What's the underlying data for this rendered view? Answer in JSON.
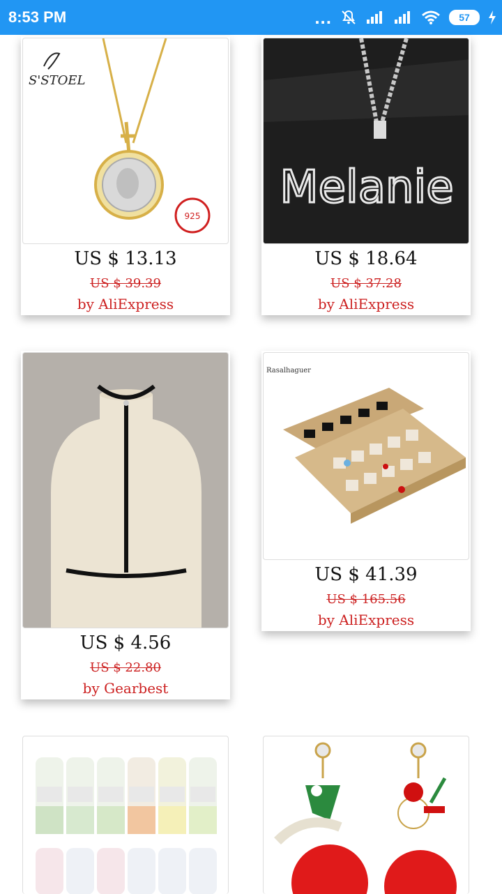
{
  "status_bar": {
    "time": "8:53 PM",
    "battery": "57",
    "dots": "..."
  },
  "products": [
    {
      "price": "US $ 13.13",
      "original_price": "US $ 39.39",
      "seller": "by AliExpress",
      "brand_mark": "S'STOEL",
      "image": "gold-pendant-necklace"
    },
    {
      "price": "US $ 18.64",
      "original_price": "US $ 37.28",
      "seller": "by AliExpress",
      "image_text": "Melanie",
      "image": "name-necklace"
    },
    {
      "price": "US $ 4.56",
      "original_price": "US $ 22.80",
      "seller": "by Gearbest",
      "image": "body-harness-choker"
    },
    {
      "price": "US $ 41.39",
      "original_price": "US $ 165.56",
      "seller": "by AliExpress",
      "brand_mark": "Rasalhaguer",
      "image": "jewelry-display-tray"
    },
    {
      "image": "resin-pigment-bottles"
    },
    {
      "image": "christmas-earrings"
    }
  ],
  "colors": {
    "status_bar": "#2196f3",
    "price_text": "#111111",
    "accent_red": "#cc2020"
  }
}
